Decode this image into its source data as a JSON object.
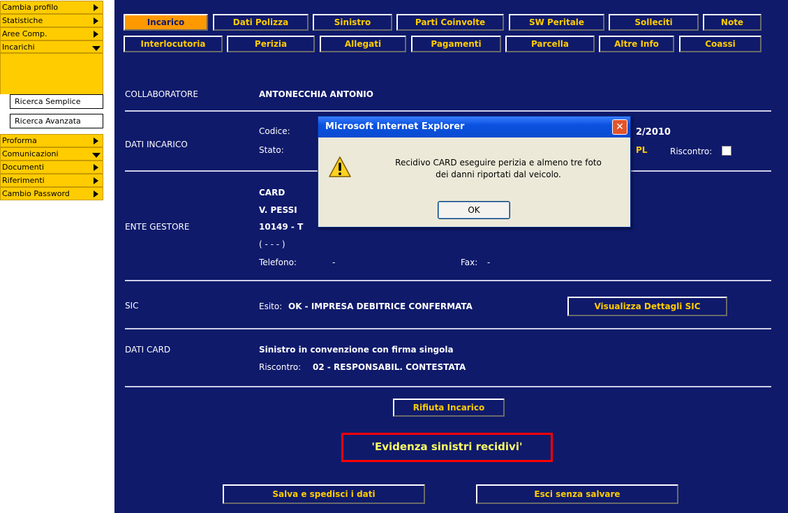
{
  "sidebar": {
    "items": [
      {
        "label": "Cambia profilo",
        "arrow": "right"
      },
      {
        "label": "Statistiche",
        "arrow": "right"
      },
      {
        "label": "Aree Comp.",
        "arrow": "right"
      },
      {
        "label": "Incarichi",
        "arrow": "down"
      },
      {
        "label": "Proforma",
        "arrow": "right"
      },
      {
        "label": "Comunicazioni",
        "arrow": "down"
      },
      {
        "label": "Documenti",
        "arrow": "right"
      },
      {
        "label": "Riferimenti",
        "arrow": "right"
      },
      {
        "label": "Cambio Password",
        "arrow": "right"
      }
    ],
    "subitems": [
      "Ricerca Semplice",
      "Ricerca Avanzata"
    ]
  },
  "tabs": {
    "row1": [
      "Incarico",
      "Dati Polizza",
      "Sinistro",
      "Parti Coinvolte",
      "SW Peritale",
      "Solleciti",
      "Note"
    ],
    "row2": [
      "Interlocutoria",
      "Perizia",
      "Allegati",
      "Pagamenti",
      "Parcella",
      "Altre Info",
      "Coassi"
    ]
  },
  "collaboratore": {
    "label": "COLLABORATORE",
    "value": "ANTONECCHIA ANTONIO"
  },
  "dati_incarico": {
    "label": "DATI INCARICO",
    "codice_label": "Codice:",
    "codice_tail": "2/2010",
    "stato_label": "Stato:",
    "stato_tail": "PL",
    "riscontro_label": "Riscontro:"
  },
  "ente_gestore": {
    "label": "ENTE GESTORE",
    "name": "CARD",
    "address": "V. PESSI",
    "cap": "10149 - T",
    "paren": "( - - - )",
    "telefono_label": "Telefono:",
    "telefono_value": "-",
    "fax_label": "Fax:",
    "fax_value": "-"
  },
  "sic": {
    "label": "SIC",
    "esito_label": "Esito:",
    "esito_value": "OK - IMPRESA DEBITRICE CONFERMATA",
    "button": "Visualizza Dettagli SIC"
  },
  "dati_card": {
    "label": "DATI CARD",
    "line1": "Sinistro in convenzione con firma singola",
    "riscontro_label": "Riscontro:",
    "riscontro_value": "02 - RESPONSABIL. CONTESTATA"
  },
  "buttons": {
    "rifiuta": "Rifiuta Incarico",
    "salva": "Salva e spedisci i dati",
    "esci": "Esci senza salvare"
  },
  "evidenza": "'Evidenza sinistri recidivi'",
  "dialog": {
    "title": "Microsoft Internet Explorer",
    "message_line1": "Recidivo CARD eseguire perizia e almeno tre foto",
    "message_line2": "dei danni riportati dal veicolo.",
    "ok": "OK"
  },
  "colors": {
    "panel": "#0f1a6b",
    "accent": "#ffcc00",
    "active_tab": "#ff9900",
    "alert": "#ff0000"
  }
}
